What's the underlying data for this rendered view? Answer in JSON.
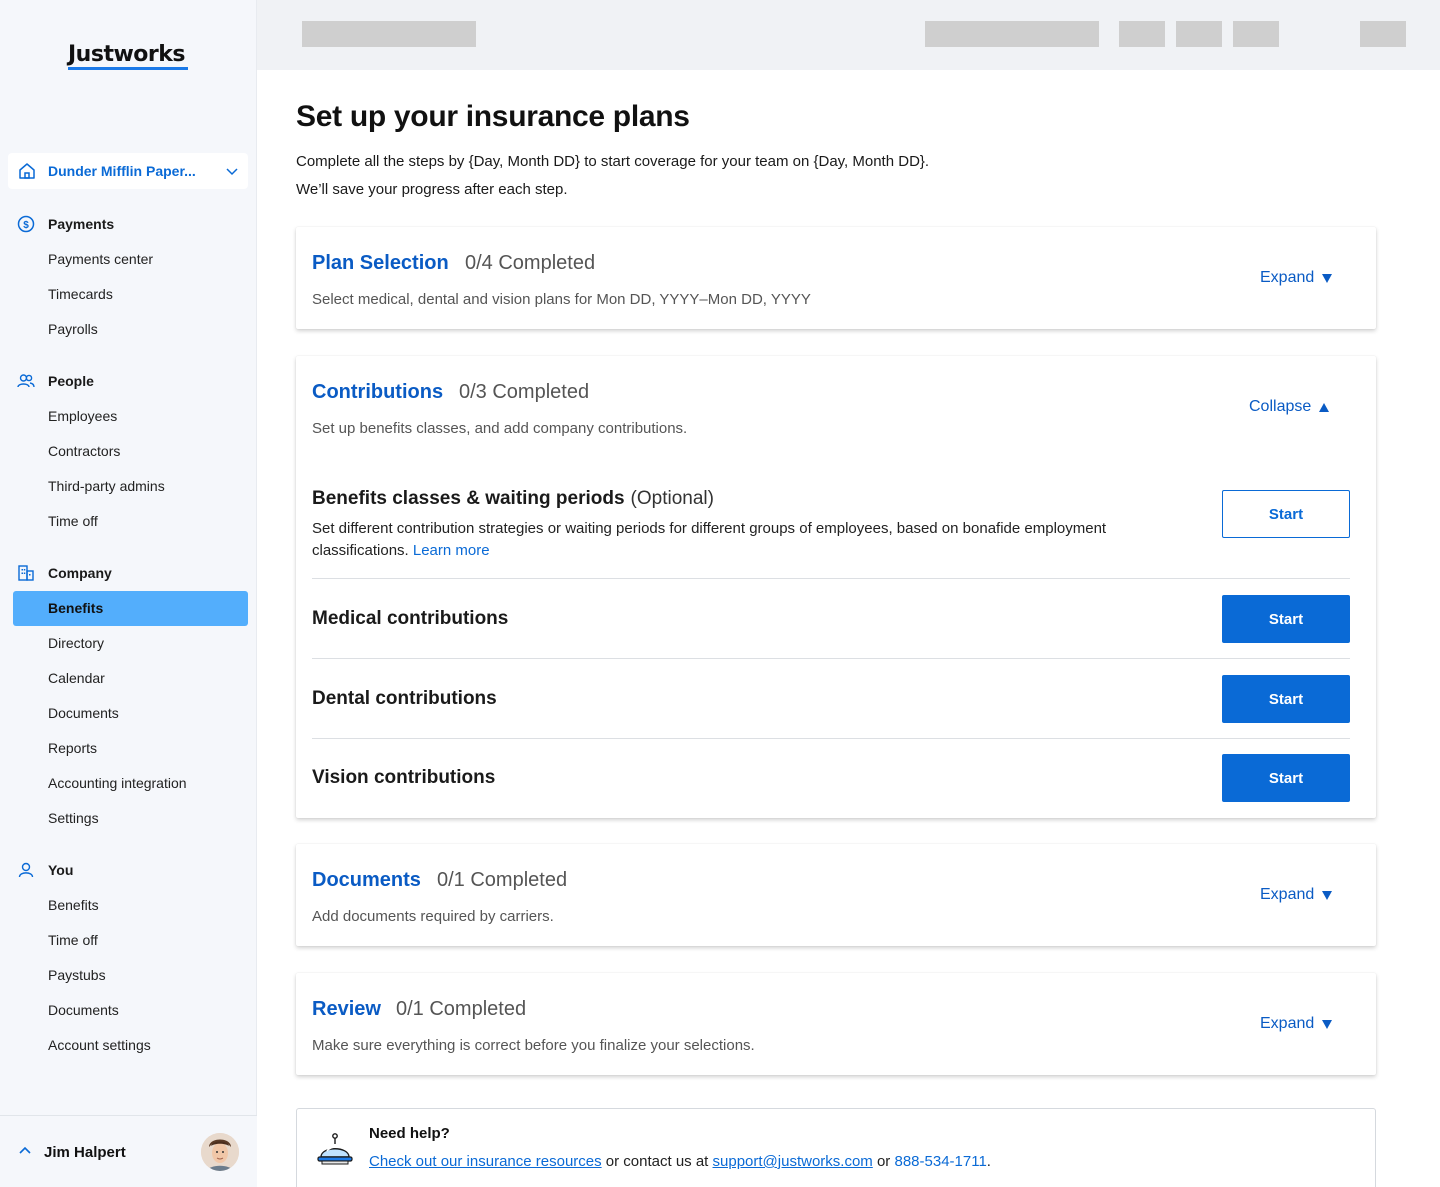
{
  "brand": {
    "logo_text": "Justworks",
    "accent": "#1c7ae8"
  },
  "company_selector": {
    "name": "Dunder Mifflin Paper...",
    "icon": "home-icon"
  },
  "sidebar": {
    "sections": [
      {
        "label": "Payments",
        "icon": "dollar-circle-icon",
        "items": [
          "Payments center",
          "Timecards",
          "Payrolls"
        ]
      },
      {
        "label": "People",
        "icon": "people-icon",
        "items": [
          "Employees",
          "Contractors",
          "Third-party admins",
          "Time off"
        ]
      },
      {
        "label": "Company",
        "icon": "building-icon",
        "items": [
          "Benefits",
          "Directory",
          "Calendar",
          "Documents",
          "Reports",
          "Accounting integration",
          "Settings"
        ]
      },
      {
        "label": "You",
        "icon": "person-icon",
        "items": [
          "Benefits",
          "Time off",
          "Paystubs",
          "Documents",
          "Account settings"
        ]
      }
    ],
    "active_item": "Company / Benefits"
  },
  "user": {
    "name": "Jim Halpert"
  },
  "page": {
    "title": "Set up your insurance plans",
    "sub1": "Complete all the steps by {Day, Month DD} to start coverage for your team on {Day, Month DD}.",
    "sub2": "We’ll save your progress after each step."
  },
  "cards": {
    "plan": {
      "title": "Plan Selection",
      "count": "0/4 Completed",
      "desc": "Select medical, dental and vision plans for Mon DD, YYYY–Mon DD, YYYY",
      "toggle": "Expand"
    },
    "contrib": {
      "title": "Contributions",
      "count": "0/3 Completed",
      "desc": "Set up benefits classes, and add company contributions.",
      "toggle": "Collapse",
      "steps": {
        "classes": {
          "title": "Benefits classes & waiting periods",
          "optional": "(Optional)",
          "desc": "Set different contribution strategies or waiting periods for different groups of employees, based on bonafide employment classifications.",
          "link": "Learn more",
          "button": "Start"
        },
        "medical": {
          "title": "Medical contributions",
          "button": "Start"
        },
        "dental": {
          "title": "Dental contributions",
          "button": "Start"
        },
        "vision": {
          "title": "Vision contributions",
          "button": "Start"
        }
      }
    },
    "docs": {
      "title": "Documents",
      "count": "0/1 Completed",
      "desc": "Add documents required by carriers.",
      "toggle": "Expand"
    },
    "review": {
      "title": "Review",
      "count": "0/1 Completed",
      "desc": "Make sure everything is correct before you finalize your selections.",
      "toggle": "Expand"
    }
  },
  "help": {
    "title": "Need help?",
    "resources_link": "Check out our insurance resources",
    "mid": " or contact us at ",
    "email": "support@justworks.com",
    "or": " or ",
    "phone": "888-534-1711",
    "end": "."
  }
}
